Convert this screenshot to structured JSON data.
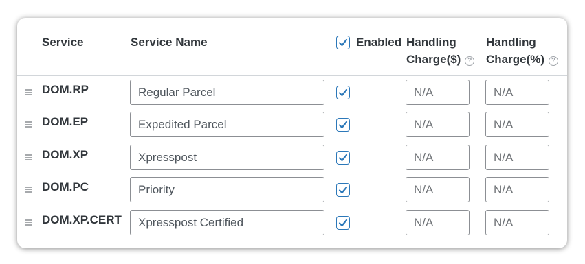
{
  "headers": {
    "service": "Service",
    "service_name": "Service Name",
    "enabled": "Enabled",
    "handling_dollar_line1": "Handling",
    "handling_dollar_line2": "Charge($)",
    "handling_percent_line1": "Handling",
    "handling_percent_line2": "Charge(%)",
    "help_icon": "help-circle-icon",
    "enabled_all_checked": true
  },
  "rows": [
    {
      "code": "DOM.RP",
      "name": "Regular Parcel",
      "enabled": true,
      "charge_dollar_placeholder": "N/A",
      "charge_percent_placeholder": "N/A"
    },
    {
      "code": "DOM.EP",
      "name": "Expedited Parcel",
      "enabled": true,
      "charge_dollar_placeholder": "N/A",
      "charge_percent_placeholder": "N/A"
    },
    {
      "code": "DOM.XP",
      "name": "Xpresspost",
      "enabled": true,
      "charge_dollar_placeholder": "N/A",
      "charge_percent_placeholder": "N/A"
    },
    {
      "code": "DOM.PC",
      "name": "Priority",
      "enabled": true,
      "charge_dollar_placeholder": "N/A",
      "charge_percent_placeholder": "N/A"
    },
    {
      "code": "DOM.XP.CERT",
      "name": "Xpresspost Certified",
      "enabled": true,
      "charge_dollar_placeholder": "N/A",
      "charge_percent_placeholder": "N/A"
    }
  ],
  "colors": {
    "checkbox_accent": "#2c78b9",
    "header_text": "#32373c",
    "border": "#8c8f94"
  }
}
